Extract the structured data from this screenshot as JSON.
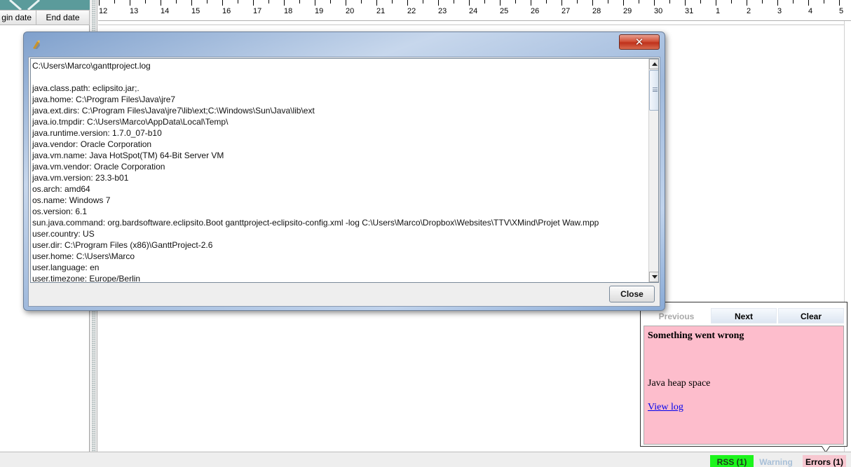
{
  "task_table": {
    "begin_date_header": "gin date",
    "end_date_header": "End date"
  },
  "timeline": {
    "days": [
      "12",
      "13",
      "14",
      "15",
      "16",
      "17",
      "18",
      "19",
      "20",
      "21",
      "22",
      "23",
      "24",
      "25",
      "26",
      "27",
      "28",
      "29",
      "30",
      "31",
      "1",
      "2",
      "3",
      "4",
      "5"
    ]
  },
  "log_dialog": {
    "icon": "ganttproject-app-icon",
    "close_glyph": "✕",
    "close_button_label": "Close",
    "log_lines": [
      "C:\\Users\\Marco\\ganttproject.log",
      "",
      "java.class.path: eclipsito.jar;.",
      "java.home: C:\\Program Files\\Java\\jre7",
      "java.ext.dirs: C:\\Program Files\\Java\\jre7\\lib\\ext;C:\\Windows\\Sun\\Java\\lib\\ext",
      "java.io.tmpdir: C:\\Users\\Marco\\AppData\\Local\\Temp\\",
      "java.runtime.version: 1.7.0_07-b10",
      "java.vendor: Oracle Corporation",
      "java.vm.name: Java HotSpot(TM) 64-Bit Server VM",
      "java.vm.vendor: Oracle Corporation",
      "java.vm.version: 23.3-b01",
      "os.arch: amd64",
      "os.name: Windows 7",
      "os.version: 6.1",
      "sun.java.command: org.bardsoftware.eclipsito.Boot ganttproject-eclipsito-config.xml -log C:\\Users\\Marco\\Dropbox\\Websites\\TTV\\XMind\\Projet Waw.mpp",
      "user.country: US",
      "user.dir: C:\\Program Files (x86)\\GanttProject-2.6",
      "user.home: C:\\Users\\Marco",
      "user.language: en",
      "user.timezone: Europe/Berlin"
    ]
  },
  "notification": {
    "previous_label": "Previous",
    "next_label": "Next",
    "clear_label": "Clear",
    "title": "Something went wrong",
    "message": "Java heap space",
    "link_label": "View log",
    "background_color": "#fdbdcc"
  },
  "status_bar": {
    "rss_label": "RSS (1)",
    "warning_label": "Warning",
    "errors_label": "Errors (1)",
    "rss_color": "#1cf51c",
    "errors_color": "#f7c7d0"
  }
}
